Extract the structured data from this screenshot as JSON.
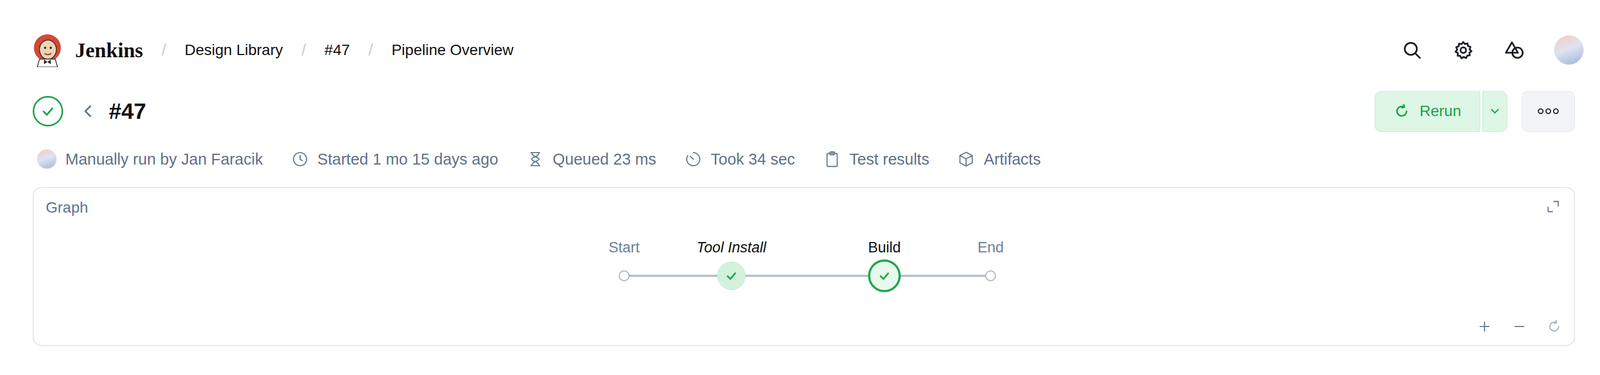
{
  "header": {
    "brand": "Jenkins",
    "separator": "/",
    "breadcrumbs": [
      {
        "label": "Design Library"
      },
      {
        "label": "#47"
      },
      {
        "label": "Pipeline Overview"
      }
    ]
  },
  "run": {
    "title": "#47",
    "status": "success",
    "rerun": "Rerun"
  },
  "meta": [
    {
      "kind": "user",
      "text": "Manually run by Jan Faracik"
    },
    {
      "kind": "started",
      "text": "Started 1 mo 15 days ago"
    },
    {
      "kind": "queued",
      "text": "Queued 23 ms"
    },
    {
      "kind": "duration",
      "text": "Took 34 sec"
    },
    {
      "kind": "tests",
      "text": "Test results"
    },
    {
      "kind": "artifacts",
      "text": "Artifacts"
    }
  ],
  "graph": {
    "title": "Graph",
    "stages": [
      {
        "name": "Start",
        "kind": "terminal",
        "status": "none",
        "synthetic": false,
        "selected": false
      },
      {
        "name": "Tool Install",
        "kind": "stage",
        "status": "success",
        "synthetic": true,
        "selected": false
      },
      {
        "name": "Build",
        "kind": "stage",
        "status": "success",
        "synthetic": false,
        "selected": true
      },
      {
        "name": "End",
        "kind": "terminal",
        "status": "none",
        "synthetic": false,
        "selected": false
      }
    ]
  }
}
